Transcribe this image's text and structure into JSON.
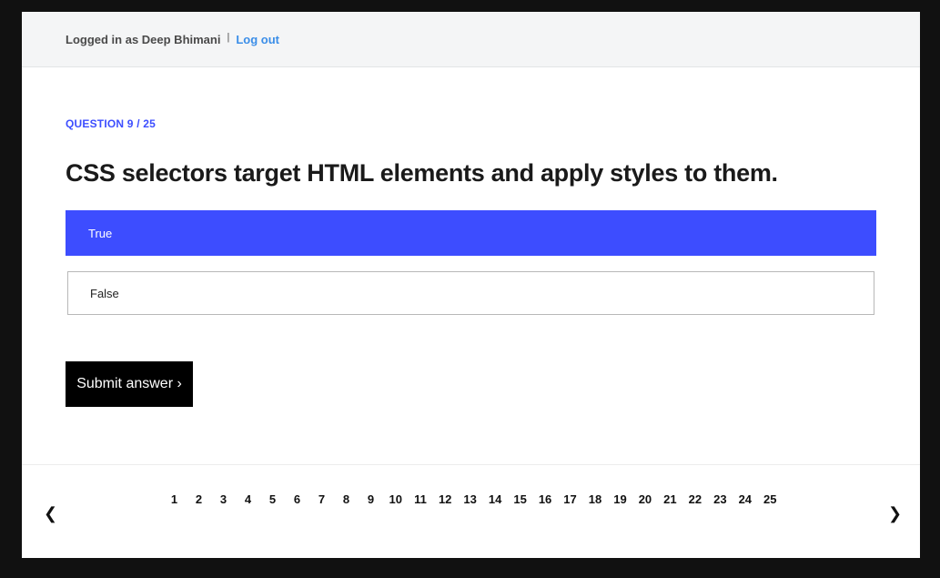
{
  "header": {
    "logged_in_text": "Logged in as Deep Bhimani",
    "separator": "|",
    "logout_label": "Log out"
  },
  "quiz": {
    "counter": "QUESTION 9 / 25",
    "question": "CSS selectors target HTML elements and apply styles to them.",
    "options": [
      {
        "label": "True",
        "selected": true
      },
      {
        "label": "False",
        "selected": false
      }
    ],
    "submit_label": "Submit answer ›"
  },
  "pagination": {
    "prev_icon": "chevron-left",
    "prev_glyph": "❮",
    "next_icon": "chevron-right",
    "next_glyph": "❯",
    "pages": [
      "1",
      "2",
      "3",
      "4",
      "5",
      "6",
      "7",
      "8",
      "9",
      "10",
      "11",
      "12",
      "13",
      "14",
      "15",
      "16",
      "17",
      "18",
      "19",
      "20",
      "21",
      "22",
      "23",
      "24",
      "25"
    ]
  },
  "colors": {
    "accent": "#3d4dff",
    "link": "#3b8ee8",
    "submit_bg": "#000000"
  }
}
